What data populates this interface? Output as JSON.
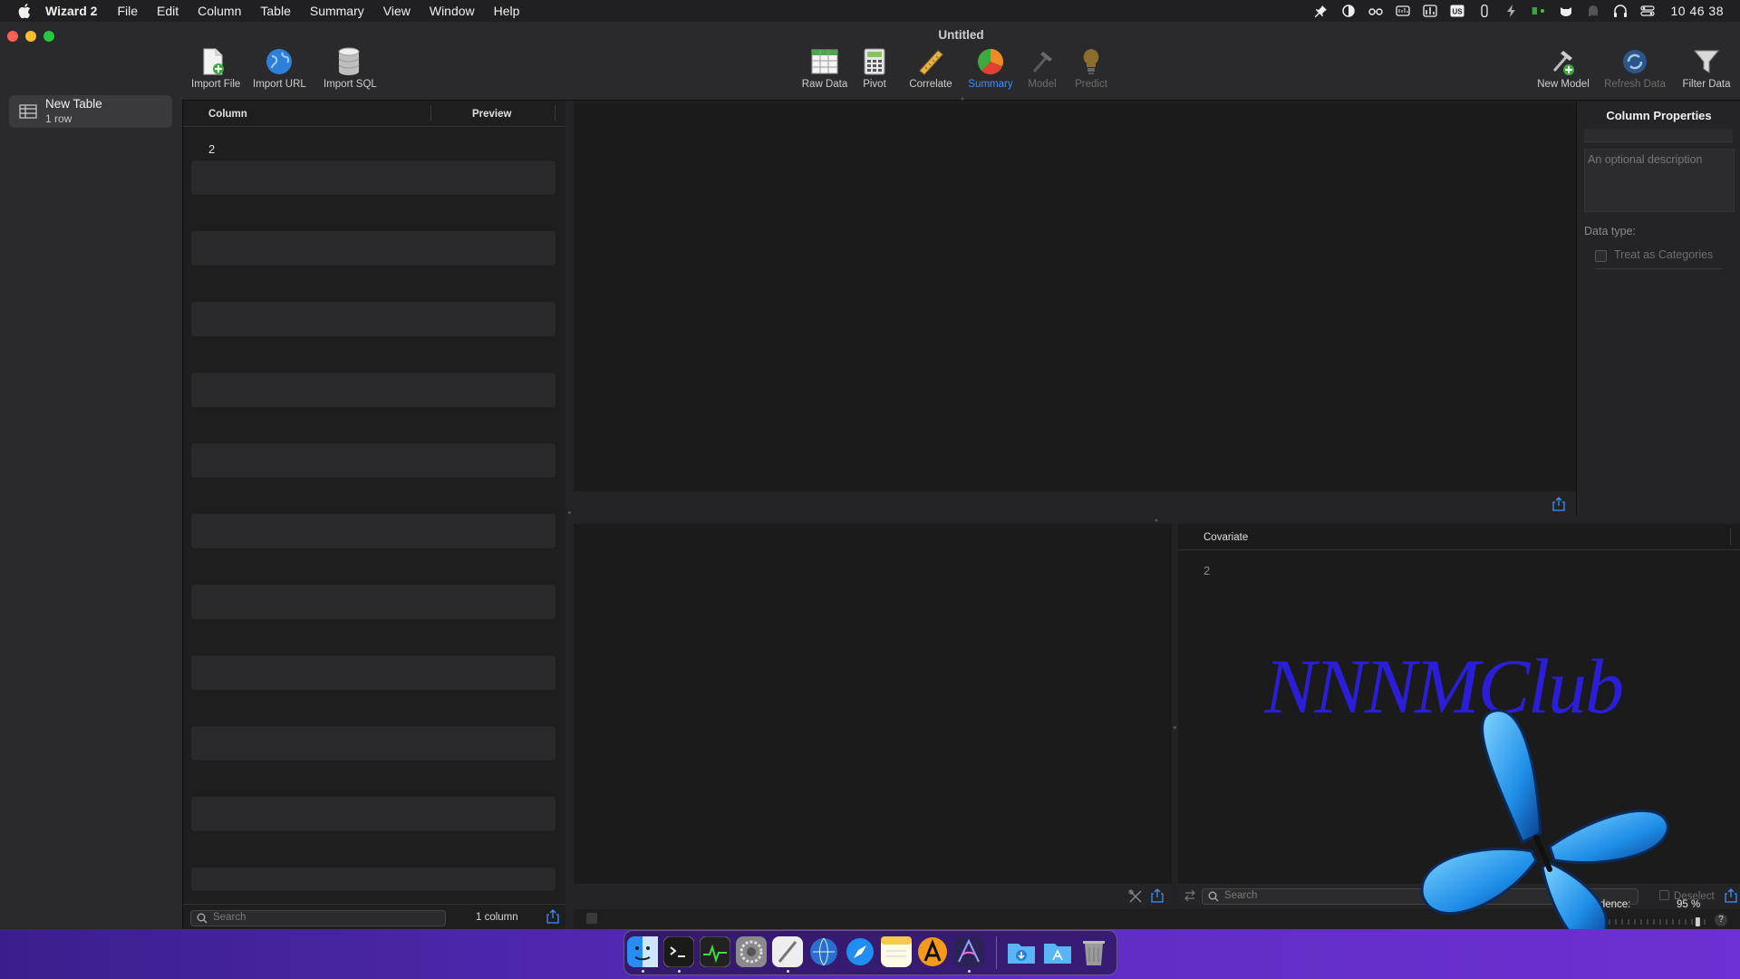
{
  "menubar": {
    "app_name": "Wizard 2",
    "items": [
      "File",
      "Edit",
      "Column",
      "Table",
      "Summary",
      "View",
      "Window",
      "Help"
    ],
    "clock": "10 46 38",
    "input_source": "US"
  },
  "window": {
    "title": "Untitled"
  },
  "sidebar": {
    "table_name": "New Table",
    "table_sub": "1 row"
  },
  "toolbar": {
    "import_file": "Import File",
    "import_url": "Import URL",
    "import_sql": "Import SQL",
    "raw_data": "Raw Data",
    "pivot": "Pivot",
    "correlate": "Correlate",
    "summary": "Summary",
    "model": "Model",
    "predict": "Predict",
    "new_model": "New Model",
    "refresh_data": "Refresh Data",
    "filter_data": "Filter Data"
  },
  "columns_pane": {
    "header_column": "Column",
    "header_preview": "Preview",
    "first_value": "2",
    "search_placeholder": "Search",
    "count": "1 column"
  },
  "properties": {
    "title": "Column Properties",
    "description_placeholder": "An optional description",
    "data_type_label": "Data type:",
    "treat_as_categories": "Treat as Categories"
  },
  "covariate": {
    "header": "Covariate",
    "value": "2",
    "search_placeholder": "Search",
    "deselect": "Deselect"
  },
  "confidence": {
    "label": "Confidence:",
    "value": "95 %",
    "level_percent": 95,
    "help": "?"
  },
  "watermark": {
    "text": "NNNMClub"
  },
  "colors": {
    "accent": "#3d8fff",
    "watermark": "#2a1fd6"
  }
}
